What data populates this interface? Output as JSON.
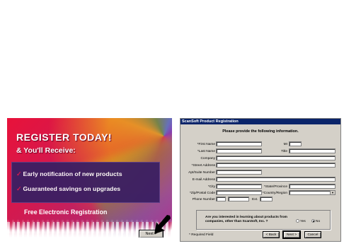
{
  "promo": {
    "title": "REGISTER TODAY!",
    "subtitle": "& You'll Receive:",
    "benefits": [
      "Early notification of new products",
      "Guaranteed savings on upgrades"
    ],
    "footer": "Free Electronic Registration",
    "next_label": "Next >",
    "check_glyph": "✓"
  },
  "dialog": {
    "title": "ScanSoft Product Registration",
    "heading": "Please provide the following information.",
    "labels": {
      "first_name": "*First Name",
      "mi": "MI",
      "last_name": "*Last Name",
      "title": "Title",
      "company": "Company",
      "street": "*Street Address",
      "apt": "Apt/Suite Number",
      "email": "E-mail Address",
      "city": "*City",
      "state": "*State/Province",
      "zip": "*Zip/Postal Code",
      "country": "*Country/Region",
      "phone": "Phone Number",
      "ext": "Ext."
    },
    "question": "Are you interested in learning about products from companies, other than ScanSoft, Inc. ?",
    "radio_yes": "Yes",
    "radio_no": "No",
    "selected_radio": "No",
    "required_note": "* Required Field",
    "buttons": {
      "back": "< Back",
      "next": "Next >",
      "cancel": "Cancel"
    }
  },
  "colors": {
    "titlebar": "#0a246a",
    "dialog_bg": "#d4d0c8",
    "promo_red": "#e8123a",
    "promo_box": "#3b1f63"
  }
}
